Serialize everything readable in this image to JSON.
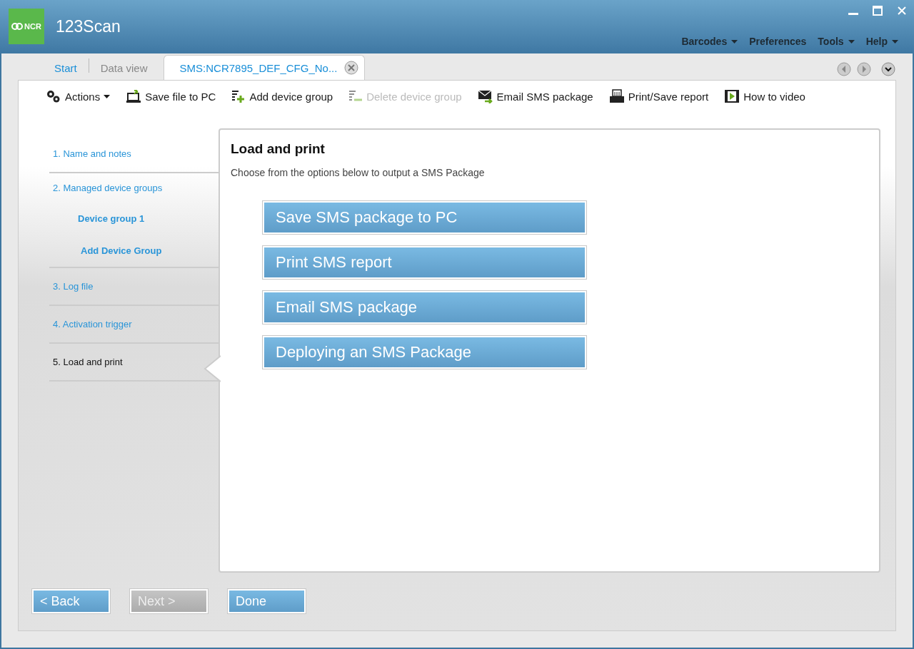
{
  "window": {
    "app_name": "123Scan",
    "logo_text": "NCR"
  },
  "menu": [
    {
      "label": "Barcodes",
      "has_dropdown": true
    },
    {
      "label": "Preferences",
      "has_dropdown": false
    },
    {
      "label": "Tools",
      "has_dropdown": true
    },
    {
      "label": "Help",
      "has_dropdown": true
    }
  ],
  "tabs": [
    {
      "label": "Start",
      "selected": false,
      "kind": "link"
    },
    {
      "label": "Data view",
      "selected": false,
      "kind": "plain"
    },
    {
      "label": "SMS:NCR7895_DEF_CFG_No...",
      "selected": true,
      "kind": "closable"
    }
  ],
  "toolbar": [
    {
      "label": "Actions",
      "kind": "gears",
      "disabled": false,
      "has_dropdown": true
    },
    {
      "label": "Save file to PC",
      "kind": "save",
      "disabled": false,
      "has_dropdown": false
    },
    {
      "label": "Add device group",
      "kind": "add",
      "disabled": false,
      "has_dropdown": false
    },
    {
      "label": "Delete device group",
      "kind": "remove",
      "disabled": true,
      "has_dropdown": false
    },
    {
      "label": "Email SMS package",
      "kind": "email",
      "disabled": false,
      "has_dropdown": false
    },
    {
      "label": "Print/Save report",
      "kind": "print",
      "disabled": false,
      "has_dropdown": false
    },
    {
      "label": "How to video",
      "kind": "video",
      "disabled": false,
      "has_dropdown": false
    }
  ],
  "steps": [
    {
      "label": "1. Name and notes",
      "selected": false
    },
    {
      "label": "2. Managed device groups",
      "selected": false,
      "children": [
        {
          "label": "Device group 1"
        },
        {
          "label": "Add Device Group"
        }
      ]
    },
    {
      "label": "3. Log file",
      "selected": false
    },
    {
      "label": "4. Activation trigger",
      "selected": false
    },
    {
      "label": "5. Load and print",
      "selected": true
    }
  ],
  "panel": {
    "title": "Load and print",
    "subtitle": "Choose from the options below to output a SMS Package",
    "options": [
      "Save SMS package to PC",
      "Print SMS report",
      "Email SMS package",
      "Deploying an SMS Package"
    ]
  },
  "footer_buttons": [
    {
      "label": "< Back",
      "disabled": false
    },
    {
      "label": "Next >",
      "disabled": true
    },
    {
      "label": "Done",
      "disabled": false
    }
  ]
}
